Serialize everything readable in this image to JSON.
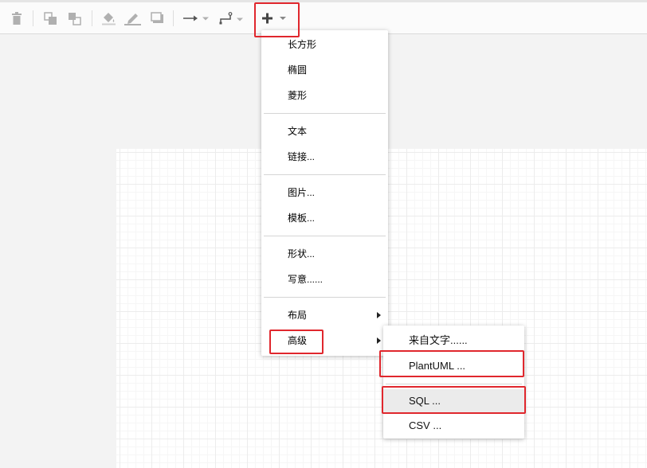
{
  "toolbar": {
    "buttons": [
      {
        "name": "delete-icon"
      },
      {
        "name": "to-front-icon"
      },
      {
        "name": "to-back-icon"
      },
      {
        "name": "fill-color-icon"
      },
      {
        "name": "line-color-icon"
      },
      {
        "name": "shadow-icon"
      },
      {
        "name": "connection-arrow-icon"
      },
      {
        "name": "waypoints-icon"
      },
      {
        "name": "insert-plus-icon"
      }
    ]
  },
  "insert_menu": {
    "items": {
      "rectangle": "长方形",
      "ellipse": "椭圆",
      "rhombus": "菱形",
      "text": "文本",
      "link": "链接...",
      "image": "图片...",
      "template": "模板...",
      "shapes": "形状...",
      "freehand": "写意......",
      "layout": "布局",
      "advanced": "高级"
    }
  },
  "advanced_submenu": {
    "items": {
      "from_text": "来自文字......",
      "plantuml": "PlantUML ...",
      "sql": "SQL ...",
      "csv": "CSV ..."
    }
  },
  "colors": {
    "highlight": "#e0272d",
    "toolbar_icon": "#b0b0b0",
    "toolbar_icon_active": "#555555",
    "hover_background": "#ebebeb"
  }
}
